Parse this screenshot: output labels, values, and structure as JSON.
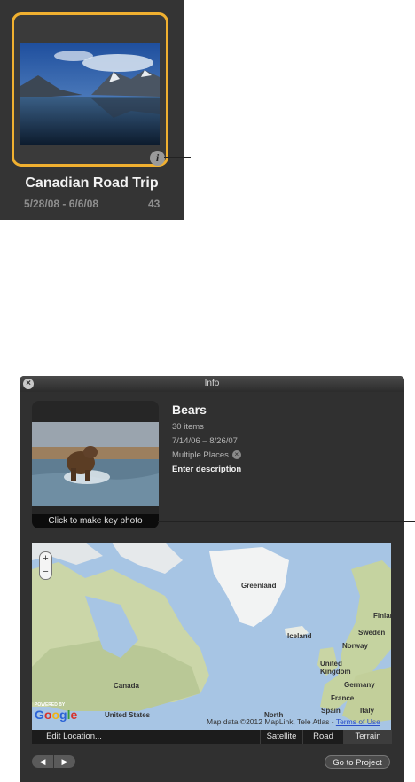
{
  "event_tile": {
    "title": "Canadian Road Trip",
    "dates": "5/28/08 - 6/6/08",
    "count": "43",
    "info_glyph": "i",
    "accent_color": "#f0b030"
  },
  "info_window": {
    "title": "Info",
    "close_glyph": "×",
    "event": {
      "name": "Bears",
      "items": "30 items",
      "dates": "7/14/06 – 8/26/07",
      "places": "Multiple Places",
      "places_clear_glyph": "×",
      "description_placeholder": "Enter description"
    },
    "key_photo_caption": "Click to make key photo",
    "map": {
      "labels": {
        "greenland": "Greenland",
        "iceland": "Iceland",
        "canada": "Canada",
        "united_kingdom_1": "United",
        "united_kingdom_2": "Kingdom",
        "norway": "Norway",
        "sweden": "Sweden",
        "finland": "Finland",
        "germany": "Germany",
        "france": "France",
        "spain": "Spain",
        "italy": "Italy",
        "united_states": "United States",
        "north": "North"
      },
      "zoom_in": "+",
      "zoom_out": "−",
      "powered_by": "POWERED BY",
      "google_letters": [
        "G",
        "o",
        "o",
        "g",
        "l",
        "e"
      ],
      "attribution": "Map data ©2012 MapLink, Tele Atlas - ",
      "terms_link": "Terms of Use"
    },
    "map_toolbar": {
      "edit_location": "Edit Location...",
      "satellite": "Satellite",
      "road": "Road",
      "terrain": "Terrain",
      "selected": "Terrain"
    },
    "nav": {
      "prev_glyph": "◀",
      "next_glyph": "▶"
    },
    "go_to_project": "Go to Project"
  }
}
